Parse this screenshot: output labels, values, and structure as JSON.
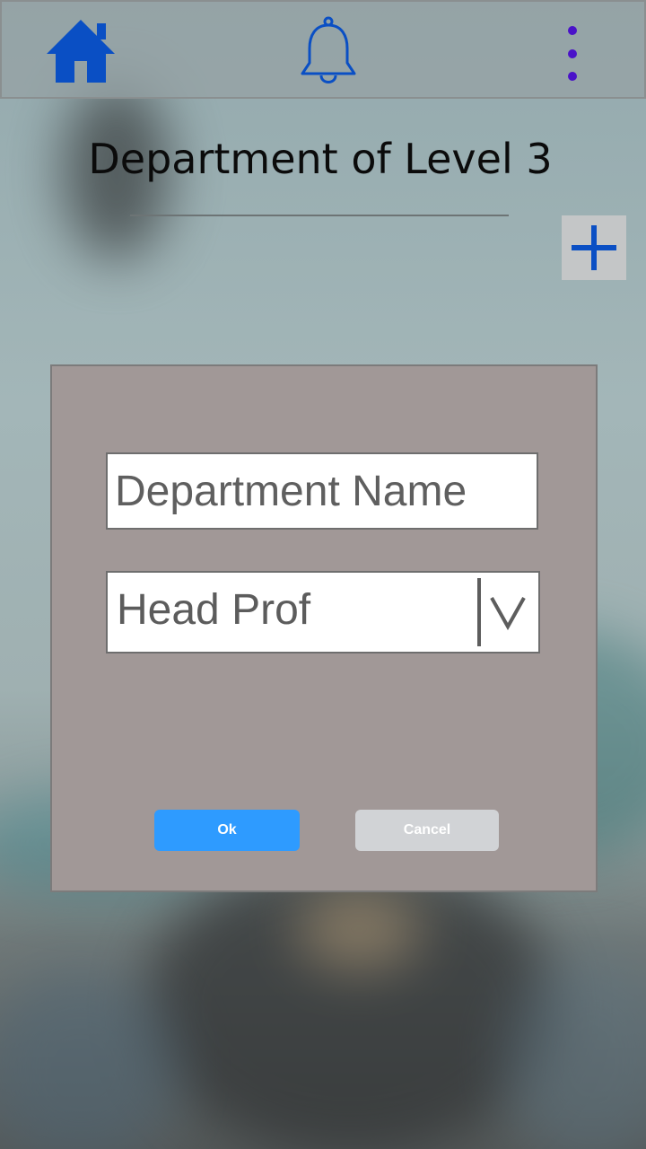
{
  "header": {
    "home_icon": "home-icon",
    "bell_icon": "bell-icon",
    "more_icon": "more-vertical-icon"
  },
  "page": {
    "title": "Department of Level 3",
    "add_icon": "plus-icon"
  },
  "dialog": {
    "department_name_placeholder": "Department Name",
    "department_name_value": "",
    "head_prof_select": "Head Prof",
    "ok_label": "Ok",
    "cancel_label": "Cancel"
  },
  "colors": {
    "accent_blue": "#0a4fc4",
    "ok_button": "#2e9bff",
    "cancel_button": "#d1d3d6",
    "more_dots": "#4a12c9",
    "dialog_bg": "#a19897"
  }
}
